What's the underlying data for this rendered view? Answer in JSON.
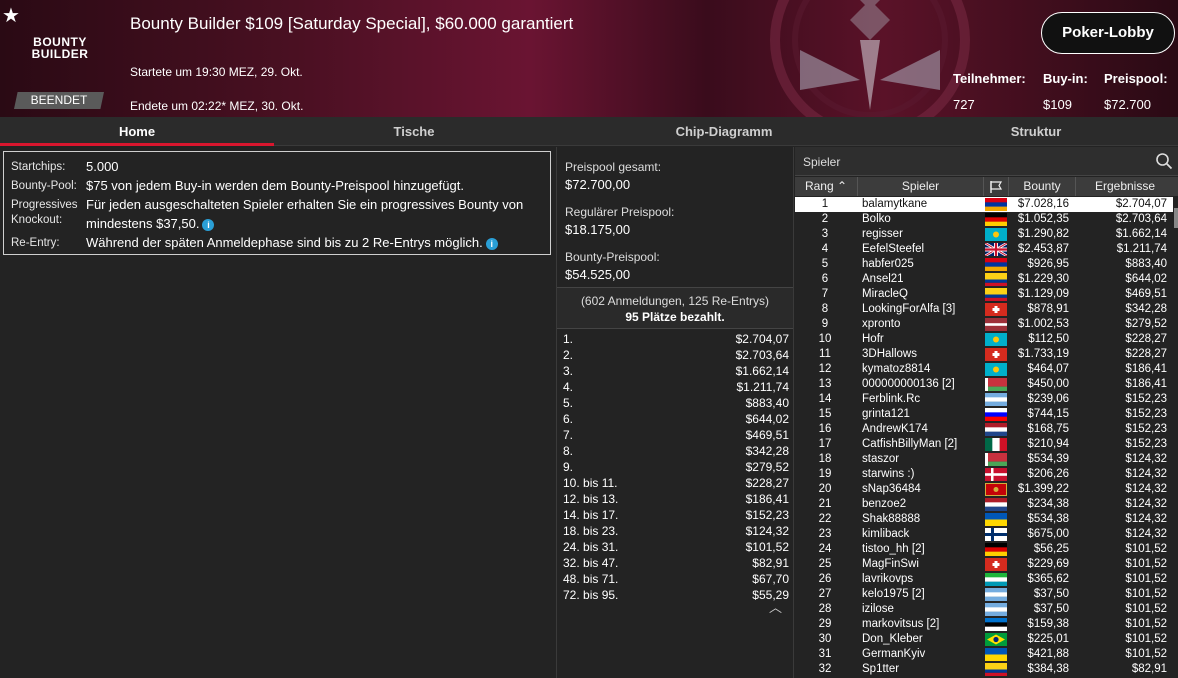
{
  "header": {
    "star": "★",
    "logo_line1": "BOUNTY",
    "logo_line2": "BUILDER",
    "status": "BEENDET",
    "title": "Bounty Builder $109 [Saturday Special], $60.000 garantiert",
    "started": "Startete um 19:30 MEZ, 29. Okt.",
    "ended": "Endete um 02:22* MEZ, 30. Okt.",
    "lobby_button": "Poker-Lobby",
    "stats": [
      {
        "label": "Teilnehmer:",
        "value": "727"
      },
      {
        "label": "Buy-in:",
        "value": "$109"
      },
      {
        "label": "Preispool:",
        "value": "$72.700"
      }
    ]
  },
  "tabs": [
    {
      "label": "Home",
      "active": true
    },
    {
      "label": "Tische",
      "active": false
    },
    {
      "label": "Chip-Diagramm",
      "active": false
    },
    {
      "label": "Struktur",
      "active": false
    }
  ],
  "info": {
    "startchips_label": "Startchips:",
    "startchips_value": "5.000",
    "bountypool_label": "Bounty-Pool:",
    "bountypool_value": "$75 von jedem Buy-in werden dem Bounty-Preispool hinzugefügt.",
    "pko_label": "Progressives Knockout:",
    "pko_value": "Für jeden ausgeschalteten Spieler erhalten Sie ein progressives Bounty von mindestens $37,50.",
    "reentry_label": "Re-Entry:",
    "reentry_value": "Während der späten Anmeldephase sind bis zu 2 Re-Entrys möglich.",
    "info_icon": "i"
  },
  "prizepool": {
    "total_label": "Preispool gesamt:",
    "total_value": "$72.700,00",
    "regular_label": "Regulärer Preispool:",
    "regular_value": "$18.175,00",
    "bounty_label": "Bounty-Preispool:",
    "bounty_value": "$54.525,00",
    "registrations": "(602 Anmeldungen, 125 Re-Entrys)",
    "paid": "95 Plätze bezahlt.",
    "payouts": [
      {
        "place": "1.",
        "amount": "$2.704,07"
      },
      {
        "place": "2.",
        "amount": "$2.703,64"
      },
      {
        "place": "3.",
        "amount": "$1.662,14"
      },
      {
        "place": "4.",
        "amount": "$1.211,74"
      },
      {
        "place": "5.",
        "amount": "$883,40"
      },
      {
        "place": "6.",
        "amount": "$644,02"
      },
      {
        "place": "7.",
        "amount": "$469,51"
      },
      {
        "place": "8.",
        "amount": "$342,28"
      },
      {
        "place": "9.",
        "amount": "$279,52"
      },
      {
        "place": "10. bis 11.",
        "amount": "$228,27"
      },
      {
        "place": "12. bis 13.",
        "amount": "$186,41"
      },
      {
        "place": "14. bis 17.",
        "amount": "$152,23"
      },
      {
        "place": "18. bis 23.",
        "amount": "$124,32"
      },
      {
        "place": "24. bis 31.",
        "amount": "$101,52"
      },
      {
        "place": "32. bis 47.",
        "amount": "$82,91"
      },
      {
        "place": "48. bis 71.",
        "amount": "$67,70"
      },
      {
        "place": "72. bis 95.",
        "amount": "$55,29"
      }
    ],
    "collapse_icon": "︿"
  },
  "players": {
    "search_placeholder": "Spieler",
    "columns": {
      "rank": "Rang",
      "player": "Spieler",
      "bounty": "Bounty",
      "results": "Ergebnisse"
    },
    "rows": [
      {
        "rank": "1",
        "name": "balamytkane",
        "flag": "armenia",
        "bounty": "$7.028,16",
        "result": "$2.704,07"
      },
      {
        "rank": "2",
        "name": "Bolko",
        "flag": "germany",
        "bounty": "$1.052,35",
        "result": "$2.703,64"
      },
      {
        "rank": "3",
        "name": "regisser",
        "flag": "kazakhstan",
        "bounty": "$1.290,82",
        "result": "$1.662,14"
      },
      {
        "rank": "4",
        "name": "EefelSteefel",
        "flag": "uk",
        "bounty": "$2.453,87",
        "result": "$1.211,74"
      },
      {
        "rank": "5",
        "name": "habfer025",
        "flag": "armenia",
        "bounty": "$926,95",
        "result": "$883,40"
      },
      {
        "rank": "6",
        "name": "Ansel21",
        "flag": "colombia",
        "bounty": "$1.229,30",
        "result": "$644,02"
      },
      {
        "rank": "7",
        "name": "MiracleQ",
        "flag": "colombia",
        "bounty": "$1.129,09",
        "result": "$469,51"
      },
      {
        "rank": "8",
        "name": "LookingForAlfa [3]",
        "flag": "switzerland",
        "bounty": "$878,91",
        "result": "$342,28"
      },
      {
        "rank": "9",
        "name": "xpronto",
        "flag": "latvia",
        "bounty": "$1.002,53",
        "result": "$279,52"
      },
      {
        "rank": "10",
        "name": "Hofr",
        "flag": "kazakhstan",
        "bounty": "$112,50",
        "result": "$228,27"
      },
      {
        "rank": "11",
        "name": "3DHallows",
        "flag": "switzerland",
        "bounty": "$1.733,19",
        "result": "$228,27"
      },
      {
        "rank": "12",
        "name": "kymatoz8814",
        "flag": "kazakhstan",
        "bounty": "$464,07",
        "result": "$186,41"
      },
      {
        "rank": "13",
        "name": "000000000136 [2]",
        "flag": "belarus",
        "bounty": "$450,00",
        "result": "$186,41"
      },
      {
        "rank": "14",
        "name": "Ferblink.Rc",
        "flag": "argentina",
        "bounty": "$239,06",
        "result": "$152,23"
      },
      {
        "rank": "15",
        "name": "grinta121",
        "flag": "slovenia",
        "bounty": "$744,15",
        "result": "$152,23"
      },
      {
        "rank": "16",
        "name": "AndrewK174",
        "flag": "netherlands",
        "bounty": "$168,75",
        "result": "$152,23"
      },
      {
        "rank": "17",
        "name": "CatfishBillyMan [2]",
        "flag": "mexico",
        "bounty": "$210,94",
        "result": "$152,23"
      },
      {
        "rank": "18",
        "name": "staszor",
        "flag": "belarus",
        "bounty": "$534,39",
        "result": "$124,32"
      },
      {
        "rank": "19",
        "name": "starwins :)",
        "flag": "denmark",
        "bounty": "$206,26",
        "result": "$124,32"
      },
      {
        "rank": "20",
        "name": "sNap36484",
        "flag": "montenegro",
        "bounty": "$1.399,22",
        "result": "$124,32"
      },
      {
        "rank": "21",
        "name": "benzoe2",
        "flag": "netherlands",
        "bounty": "$234,38",
        "result": "$124,32"
      },
      {
        "rank": "22",
        "name": "Shak88888",
        "flag": "ukraine",
        "bounty": "$534,38",
        "result": "$124,32"
      },
      {
        "rank": "23",
        "name": "kimliback",
        "flag": "finland",
        "bounty": "$675,00",
        "result": "$124,32"
      },
      {
        "rank": "24",
        "name": "tistoo_hh [2]",
        "flag": "germany",
        "bounty": "$56,25",
        "result": "$101,52"
      },
      {
        "rank": "25",
        "name": "MagFinSwi",
        "flag": "switzerland",
        "bounty": "$229,69",
        "result": "$101,52"
      },
      {
        "rank": "26",
        "name": "lavrikovps",
        "flag": "uzbekistan",
        "bounty": "$365,62",
        "result": "$101,52"
      },
      {
        "rank": "27",
        "name": "kelo1975 [2]",
        "flag": "argentina",
        "bounty": "$37,50",
        "result": "$101,52"
      },
      {
        "rank": "28",
        "name": "izilose",
        "flag": "argentina",
        "bounty": "$37,50",
        "result": "$101,52"
      },
      {
        "rank": "29",
        "name": "markovitsus [2]",
        "flag": "estonia",
        "bounty": "$159,38",
        "result": "$101,52"
      },
      {
        "rank": "30",
        "name": "Don_Kleber",
        "flag": "brazil",
        "bounty": "$225,01",
        "result": "$101,52"
      },
      {
        "rank": "31",
        "name": "GermanKyiv",
        "flag": "ukraine",
        "bounty": "$421,88",
        "result": "$101,52"
      },
      {
        "rank": "32",
        "name": "Sp1tter",
        "flag": "colombia",
        "bounty": "$384,38",
        "result": "$82,91"
      }
    ]
  },
  "colors": {
    "accent": "#d9162e",
    "selected_row": "#ffffff",
    "info_icon": "#2a9fd6"
  }
}
